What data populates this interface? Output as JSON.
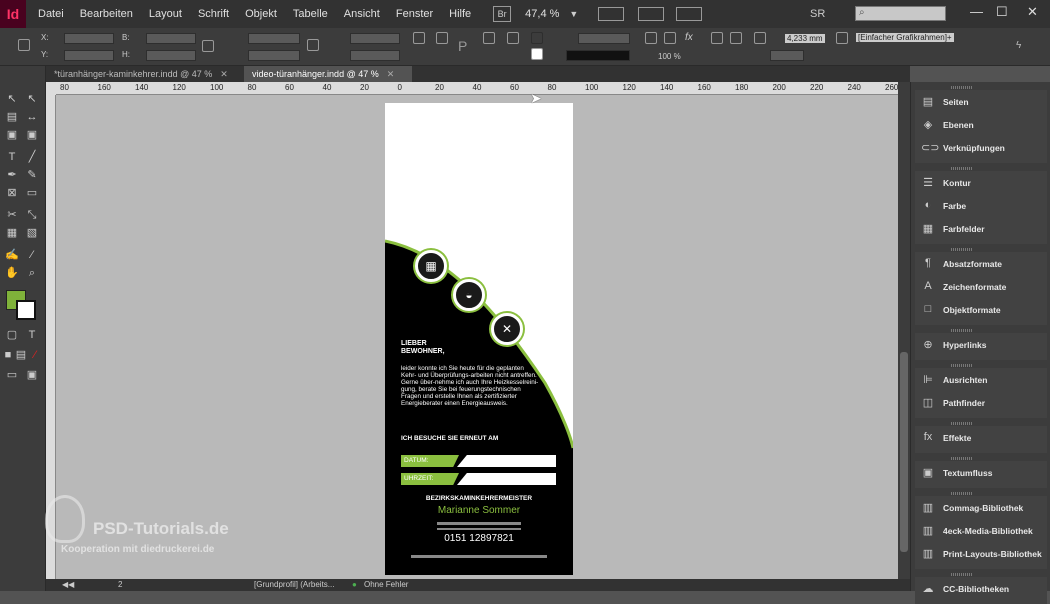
{
  "app": {
    "logo": "Id",
    "menus": [
      "Datei",
      "Bearbeiten",
      "Layout",
      "Schrift",
      "Objekt",
      "Tabelle",
      "Ansicht",
      "Fenster",
      "Hilfe"
    ],
    "bridge": "Br",
    "zoom": "47,4 %",
    "workspace": "SR",
    "search_placeholder": ""
  },
  "window_controls": {
    "minimize": "—",
    "maximize": "☐",
    "close": "✕"
  },
  "control_bar": {
    "x_label": "X:",
    "y_label": "Y:",
    "b_label": "B:",
    "h_label": "H:",
    "stroke_weight": "4,233 mm",
    "opacity": "100 %",
    "frame_style": "[Einfacher Grafikrahmen]+",
    "fill_color": "#7fb23a"
  },
  "tabs": [
    {
      "label": "*türanhänger-kaminkehrer.indd @ 47 %",
      "active": false
    },
    {
      "label": "video-türanhänger.indd @ 47 %",
      "active": true
    }
  ],
  "ruler_ticks": [
    "80",
    "160",
    "140",
    "120",
    "100",
    "80",
    "60",
    "40",
    "20",
    "0",
    "20",
    "40",
    "60",
    "80",
    "100",
    "120",
    "140",
    "160",
    "180",
    "200",
    "220",
    "240",
    "260"
  ],
  "document": {
    "greeting": "LIEBER BEWOHNER,",
    "body": "leider konnte ich Sie heute für die geplanten Kehr- und Überprüfungs-arbeiten nicht antreffen. Gerne über-nehme ich auch Ihre Heizkesselreini-gung, berate Sie bei feuerungstechnischen Fragen und erstelle Ihnen als zertifizierter Energieberater einen Energieausweis.",
    "visit": "ICH BESUCHE SIE ERNEUT AM",
    "date_label": "DATUM:",
    "time_label": "UHRZEIT:",
    "master": "BEZIRKSKAMINKEHRERMEISTER",
    "name": "Marianne Sommer",
    "phone": "0151 12897821",
    "accent_color": "#8bbf3f"
  },
  "watermark": {
    "main": "PSD-Tutorials.de",
    "sub": "Kooperation mit   diedruckerei.de"
  },
  "status": {
    "page": "2",
    "profile": "[Grundprofil] (Arbeits...",
    "errors": "Ohne Fehler"
  },
  "panels": [
    {
      "group": [
        {
          "icon": "pages-icon",
          "glyph": "▤",
          "label": "Seiten"
        },
        {
          "icon": "layers-icon",
          "glyph": "◈",
          "label": "Ebenen"
        },
        {
          "icon": "links-icon",
          "glyph": "⊂⊃",
          "label": "Verknüpfungen"
        }
      ]
    },
    {
      "group": [
        {
          "icon": "stroke-icon",
          "glyph": "☰",
          "label": "Kontur"
        },
        {
          "icon": "color-icon",
          "glyph": "◐",
          "label": "Farbe"
        },
        {
          "icon": "swatches-icon",
          "glyph": "▦",
          "label": "Farbfelder"
        }
      ]
    },
    {
      "group": [
        {
          "icon": "paragraph-styles-icon",
          "glyph": "¶",
          "label": "Absatzformate"
        },
        {
          "icon": "character-styles-icon",
          "glyph": "A",
          "label": "Zeichenformate"
        },
        {
          "icon": "object-styles-icon",
          "glyph": "□",
          "label": "Objektformate"
        }
      ]
    },
    {
      "group": [
        {
          "icon": "hyperlinks-icon",
          "glyph": "⊕",
          "label": "Hyperlinks"
        }
      ]
    },
    {
      "group": [
        {
          "icon": "align-icon",
          "glyph": "⊫",
          "label": "Ausrichten"
        },
        {
          "icon": "pathfinder-icon",
          "glyph": "◫",
          "label": "Pathfinder"
        }
      ]
    },
    {
      "group": [
        {
          "icon": "effects-icon",
          "glyph": "fx",
          "label": "Effekte"
        }
      ]
    },
    {
      "group": [
        {
          "icon": "text-wrap-icon",
          "glyph": "▣",
          "label": "Textumfluss"
        }
      ]
    },
    {
      "group": [
        {
          "icon": "library-icon",
          "glyph": "▥",
          "label": "Commag-Bibliothek"
        },
        {
          "icon": "library-icon",
          "glyph": "▥",
          "label": "4eck-Media-Bibliothek"
        },
        {
          "icon": "library-icon",
          "glyph": "▥",
          "label": "Print-Layouts-Bibliothek"
        }
      ]
    },
    {
      "group": [
        {
          "icon": "cc-libraries-icon",
          "glyph": "☁",
          "label": "CC-Bibliotheken"
        }
      ]
    }
  ]
}
